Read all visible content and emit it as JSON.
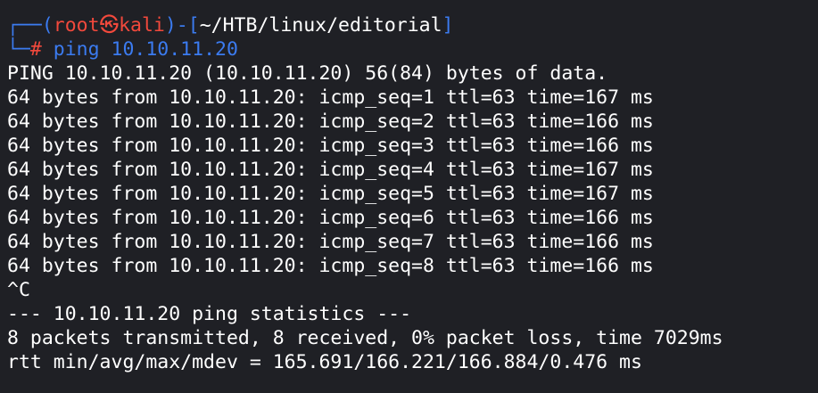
{
  "prompt": {
    "corner_top": "┌──",
    "open_paren": "(",
    "user": "root",
    "at_symbol": "㉿",
    "host": "kali",
    "close_paren_dash_bracket": ")-[",
    "path": "~/HTB/linux/editorial",
    "close_bracket": "]",
    "corner_bottom": "└─",
    "hash": "#",
    "command": "ping 10.10.11.20"
  },
  "output": {
    "header": "PING 10.10.11.20 (10.10.11.20) 56(84) bytes of data.",
    "replies": [
      "64 bytes from 10.10.11.20: icmp_seq=1 ttl=63 time=167 ms",
      "64 bytes from 10.10.11.20: icmp_seq=2 ttl=63 time=166 ms",
      "64 bytes from 10.10.11.20: icmp_seq=3 ttl=63 time=166 ms",
      "64 bytes from 10.10.11.20: icmp_seq=4 ttl=63 time=167 ms",
      "64 bytes from 10.10.11.20: icmp_seq=5 ttl=63 time=167 ms",
      "64 bytes from 10.10.11.20: icmp_seq=6 ttl=63 time=166 ms",
      "64 bytes from 10.10.11.20: icmp_seq=7 ttl=63 time=166 ms",
      "64 bytes from 10.10.11.20: icmp_seq=8 ttl=63 time=166 ms"
    ],
    "interrupt": "^C",
    "stats_header": "--- 10.10.11.20 ping statistics ---",
    "stats_packets": "8 packets transmitted, 8 received, 0% packet loss, time 7029ms",
    "stats_rtt": "rtt min/avg/max/mdev = 165.691/166.221/166.884/0.476 ms"
  },
  "colors": {
    "background": "#1f2025",
    "prompt_blue": "#3b7bf0",
    "prompt_red": "#f2493c",
    "text": "#ffffff"
  }
}
